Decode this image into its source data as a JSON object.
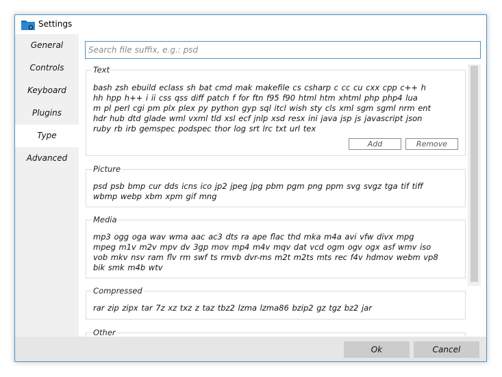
{
  "window": {
    "title": "Settings"
  },
  "sidebar": {
    "items": [
      {
        "label": "General"
      },
      {
        "label": "Controls"
      },
      {
        "label": "Keyboard"
      },
      {
        "label": "Plugins"
      },
      {
        "label": "Type"
      },
      {
        "label": "Advanced"
      }
    ],
    "active": "Type"
  },
  "search": {
    "placeholder": "Search file suffix, e.g.: psd",
    "value": ""
  },
  "groups": {
    "text": {
      "title": "Text",
      "line1": "bash  zsh  ebuild  eclass  sh  bat  cmd  mak  makefile  cs  csharp  c  cc  cu  cxx  cpp  c++  h",
      "line2": "hh  hpp  h++  i  ii  css  qss  diff  patch  f  for  ftn  f95  f90  html  htm  xhtml  php  php4  lua",
      "line3": "m  pl  perl  cgi  pm  plx  plex  py  python  gyp  sql  itcl  wish  sty  cls  xml  sgm  sgml  nrm  ent",
      "line4": "hdr  hub  dtd  glade  wml  vxml  tld  xsl  ecf  jnlp  xsd  resx  ini  java  jsp  js  javascript  json",
      "line5": "ruby  rb  irb  gemspec  podspec  thor  log  srt  lrc  txt  url  tex",
      "add_label": "Add",
      "remove_label": "Remove"
    },
    "picture": {
      "title": "Picture",
      "line1": "psd  psb  bmp  cur  dds  icns  ico  jp2  jpeg  jpg  pbm  pgm  png  ppm  svg  svgz  tga  tif  tiff",
      "line2": "wbmp  webp  xbm  xpm  gif  mng"
    },
    "media": {
      "title": "Media",
      "line1": "mp3  ogg  oga  wav  wma  aac  ac3  dts  ra  ape  flac  thd  mka  m4a  avi  vfw  divx  mpg",
      "line2": "mpeg  m1v  m2v  mpv  dv  3gp  mov  mp4  m4v  mqv  dat  vcd  ogm  ogv  ogx  asf  wmv  iso",
      "line3": "vob  mkv  nsv  ram  flv  rm  swf  ts  rmvb  dvr-ms  m2t  m2ts  mts  rec  f4v  hdmov  webm  vp8",
      "line4": "bik  smk  m4b  wtv"
    },
    "compressed": {
      "title": "Compressed",
      "line1": "rar  zip  zipx  tar  7z  xz  txz  z  taz  tbz2  lzma  lzma86  bzip2  gz  tgz  bz2  jar"
    },
    "other": {
      "title": "Other"
    }
  },
  "footer": {
    "ok_label": "Ok",
    "cancel_label": "Cancel"
  },
  "colors": {
    "accent": "#4a90c8",
    "button": "#cccccc",
    "footer": "#e6e6e6"
  }
}
